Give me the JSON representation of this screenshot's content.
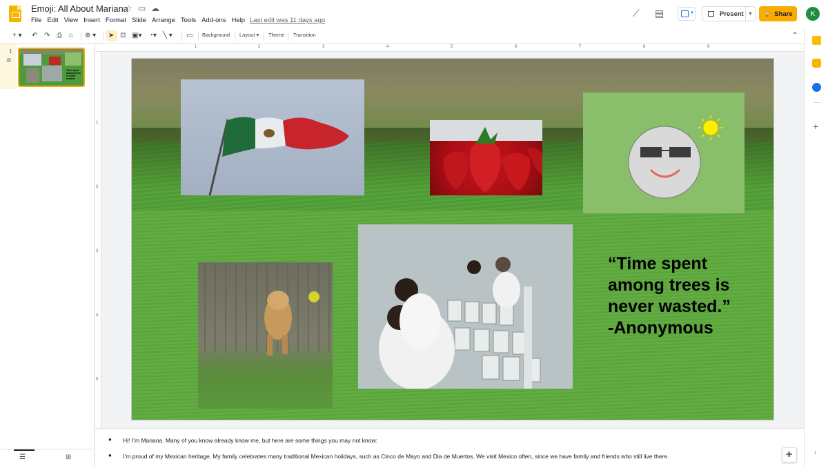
{
  "app": {
    "doc_title": "Emoji: All About Mariana",
    "last_edit": "Last edit was 11 days ago",
    "menu": [
      "File",
      "Edit",
      "View",
      "Insert",
      "Format",
      "Slide",
      "Arrange",
      "Tools",
      "Add-ons",
      "Help"
    ],
    "present_label": "Present",
    "share_label": "Share",
    "avatar_letter": "K"
  },
  "toolbar": {
    "background_label": "Background",
    "layout_label": "Layout",
    "theme_label": "Theme",
    "transition_label": "Transition"
  },
  "filmstrip": {
    "slide_number": "1",
    "thumb_text": "Time spent among trees is never wasted."
  },
  "ruler": {
    "h_ticks": [
      "1",
      "2",
      "3",
      "4",
      "5",
      "6",
      "7",
      "8",
      "9"
    ],
    "v_ticks": [
      "1",
      "2",
      "3",
      "4",
      "5"
    ]
  },
  "slide": {
    "quote_lines": [
      "“Time spent",
      "among trees is",
      "never wasted.”",
      "-Anonymous"
    ]
  },
  "notes": {
    "items": [
      "Hi! I’m Mariana. Many of you know already know me, but here are some things you may not know:",
      "I’m proud of my Mexican heritage. My family celebrates many traditional Mexican holidays, such as Cinco de Mayo and Dia de Muertos. We visit Mexico often, since we have family and friends who still live there."
    ]
  },
  "colors": {
    "accent": "#f9ab00",
    "avatar": "#1e8e3e",
    "emoji_bg": "#89bf6b"
  }
}
